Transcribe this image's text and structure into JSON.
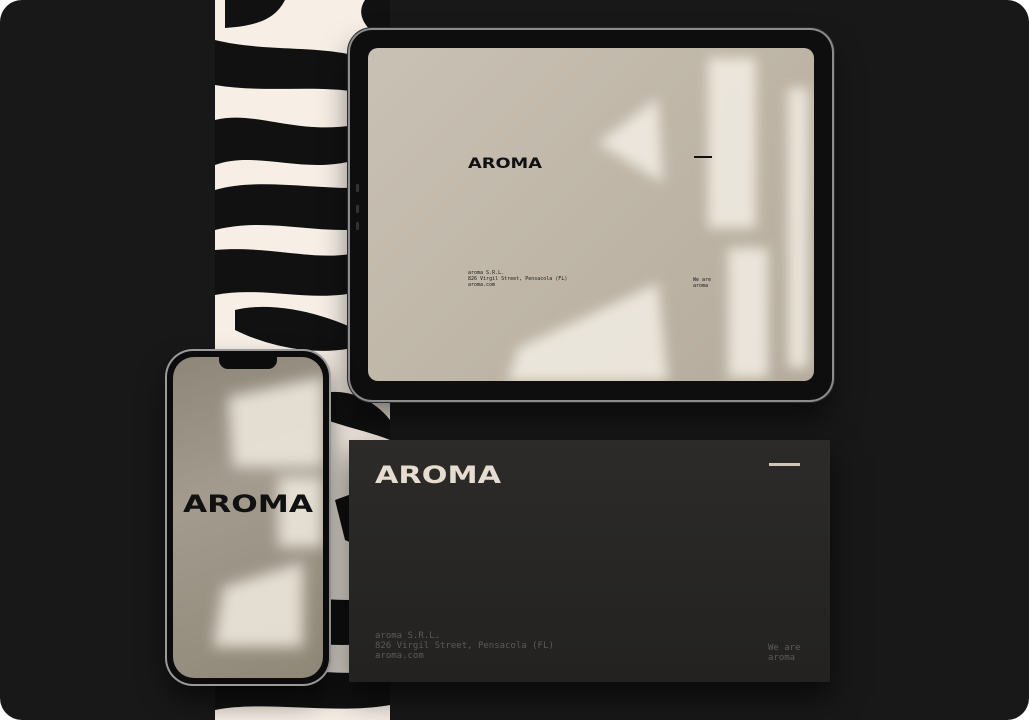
{
  "brand": {
    "logo_text": "AROMA"
  },
  "tablet": {
    "company": "aroma S.R.L.",
    "street": "826 Virgil Street, Pensacola (FL)",
    "website": "aroma.com",
    "tagline_1": "We are",
    "tagline_2": "aroma"
  },
  "envelope": {
    "company": "aroma S.R.L.",
    "street": "826 Virgil Street, Pensacola (FL)",
    "website": "aroma.com",
    "tagline_1": "We are",
    "tagline_2": "aroma"
  },
  "colors": {
    "background": "#181818",
    "cream": "#f7efe6",
    "envelope": "#262523",
    "ink": "#111111"
  }
}
